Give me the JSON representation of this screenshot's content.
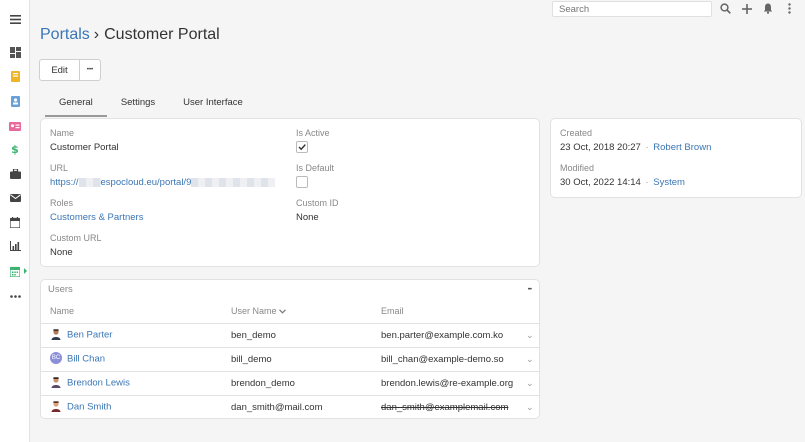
{
  "header": {
    "search_placeholder": "Search",
    "icons": [
      "search-icon",
      "plus-icon",
      "bell-icon",
      "kebab-menu-icon"
    ]
  },
  "sidebar": {
    "items": [
      "menu-icon",
      "dashboard-icon",
      "bookmark-icon",
      "contact-icon",
      "id-card-icon",
      "dollar-icon",
      "briefcase-icon",
      "envelope-icon",
      "calendar-icon",
      "chart-icon",
      "calendar-active-icon",
      "more-icon"
    ]
  },
  "breadcrumb": {
    "parent": "Portals",
    "separator": "›",
    "current": "Customer Portal"
  },
  "actions": {
    "edit_label": "Edit",
    "more_label": "•••"
  },
  "tabs": [
    "General",
    "Settings",
    "User Interface"
  ],
  "fields": {
    "name_label": "Name",
    "name_value": "Customer Portal",
    "url_label": "URL",
    "url_prefix": "https://",
    "url_mid": "espocloud.eu/portal/",
    "url_suffix": "9",
    "roles_label": "Roles",
    "roles_value": "Customers & Partners",
    "custom_url_label": "Custom URL",
    "custom_url_value": "None",
    "is_active_label": "Is Active",
    "is_active_value": true,
    "is_default_label": "Is Default",
    "is_default_value": false,
    "custom_id_label": "Custom ID",
    "custom_id_value": "None"
  },
  "side": {
    "created_label": "Created",
    "created_date": "23 Oct, 2018 20:27",
    "created_by": "Robert Brown",
    "modified_label": "Modified",
    "modified_date": "30 Oct, 2022 14:14",
    "modified_by": "System",
    "dot": "·"
  },
  "users": {
    "title": "Users",
    "menu": "•••",
    "columns": {
      "name": "Name",
      "user_name": "User Name",
      "email": "Email"
    },
    "rows": [
      {
        "name": "Ben Parter",
        "user_name": "ben_demo",
        "email": "ben.parter@example.com.ko",
        "action": "⌄"
      },
      {
        "name": "Bill Chan",
        "user_name": "bill_demo",
        "email": "bill_chan@example-demo.so",
        "action": "⌄",
        "initials": "BC"
      },
      {
        "name": "Brendon Lewis",
        "user_name": "brendon_demo",
        "email": "brendon.lewis@re-example.org",
        "action": "⌄"
      },
      {
        "name": "Dan Smith",
        "user_name": "dan_smith@mail.com",
        "email": "dan_smith@examplemail.com",
        "action": "⌄"
      }
    ]
  },
  "colors": {
    "link": "#3a76b5",
    "accent_sidebar": "#3cb371",
    "dollar": "#3cb371",
    "bookmark": "#f0b429",
    "contact": "#6aa0d8",
    "id_card": "#e86a9a",
    "active_calendar": "#3cb371"
  }
}
